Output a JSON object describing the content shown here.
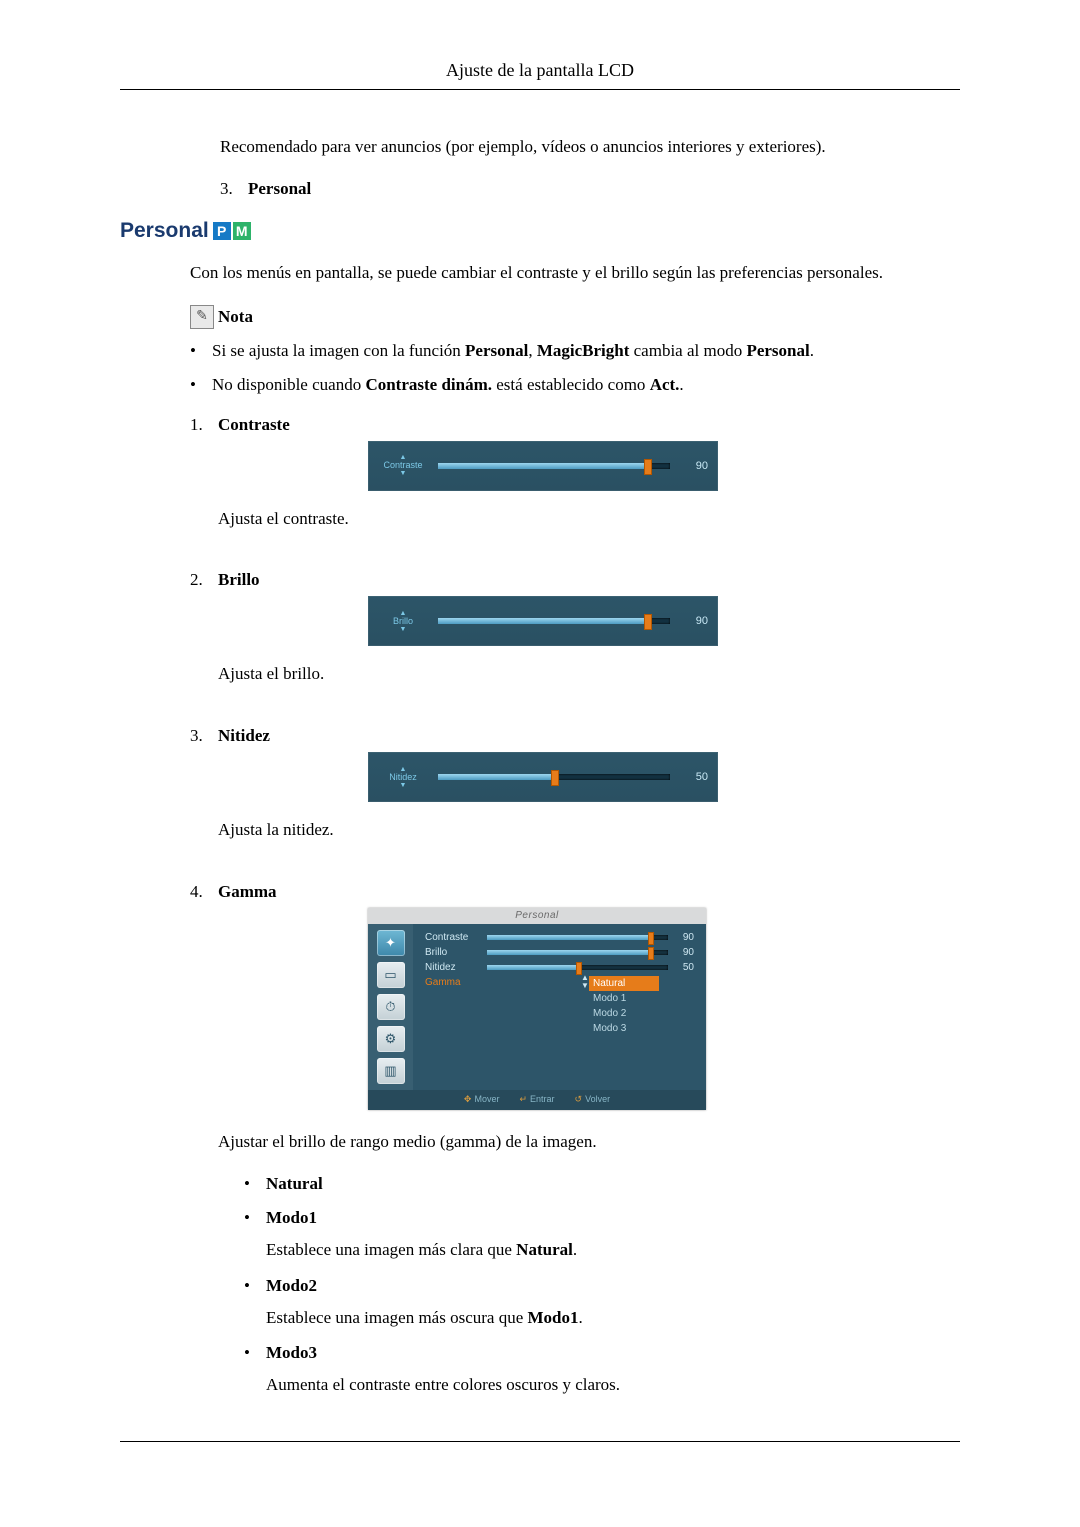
{
  "header": {
    "title": "Ajuste de la pantalla LCD"
  },
  "intro": {
    "recommended": "Recomendado para ver anuncios (por ejemplo, vídeos o anuncios interiores y exteriores).",
    "item3_num": "3.",
    "item3_label": "Personal"
  },
  "section": {
    "title": "Personal",
    "badge_p": "P",
    "badge_m": "M"
  },
  "personal_intro": "Con los menús en pantalla, se puede cambiar el contraste y el brillo según las preferencias personales.",
  "nota_label": "Nota",
  "notes": {
    "n1_pre": "Si se ajusta la imagen con la función ",
    "n1_b1": "Personal",
    "n1_mid": ", ",
    "n1_b2": "MagicBright",
    "n1_post": " cambia al modo ",
    "n1_b3": "Personal",
    "n1_end": ".",
    "n2_pre": "No disponible cuando ",
    "n2_b1": "Contraste dinám.",
    "n2_mid": " está establecido como ",
    "n2_b2": "Act.",
    "n2_end": "."
  },
  "items": {
    "contraste": {
      "num": "1.",
      "title": "Contraste",
      "osd_label": "Contraste",
      "value": "90",
      "desc": "Ajusta el contraste."
    },
    "brillo": {
      "num": "2.",
      "title": "Brillo",
      "osd_label": "Brillo",
      "value": "90",
      "desc": "Ajusta el brillo."
    },
    "nitidez": {
      "num": "3.",
      "title": "Nitidez",
      "osd_label": "Nitidez",
      "value": "50",
      "desc": "Ajusta la nitidez."
    },
    "gamma": {
      "num": "4.",
      "title": "Gamma",
      "menu_title": "Personal",
      "rows": {
        "contraste": {
          "label": "Contraste",
          "value": "90"
        },
        "brillo": {
          "label": "Brillo",
          "value": "90"
        },
        "nitidez": {
          "label": "Nitidez",
          "value": "50"
        },
        "gamma": {
          "label": "Gamma"
        }
      },
      "options": {
        "natural": "Natural",
        "modo1": "Modo 1",
        "modo2": "Modo 2",
        "modo3": "Modo 3"
      },
      "footer": {
        "move": "Mover",
        "enter": "Entrar",
        "back": "Volver"
      },
      "desc": "Ajustar el brillo de rango medio (gamma) de la imagen.",
      "modes": {
        "natural": "Natural",
        "modo1": "Modo1",
        "modo1_desc_pre": "Establece una imagen más clara que ",
        "modo1_desc_b": "Natural",
        "modo1_desc_end": ".",
        "modo2": "Modo2",
        "modo2_desc_pre": "Establece una imagen más oscura que ",
        "modo2_desc_b": "Modo1",
        "modo2_desc_end": ".",
        "modo3": "Modo3",
        "modo3_desc": "Aumenta el contraste entre colores oscuros y claros."
      }
    }
  }
}
